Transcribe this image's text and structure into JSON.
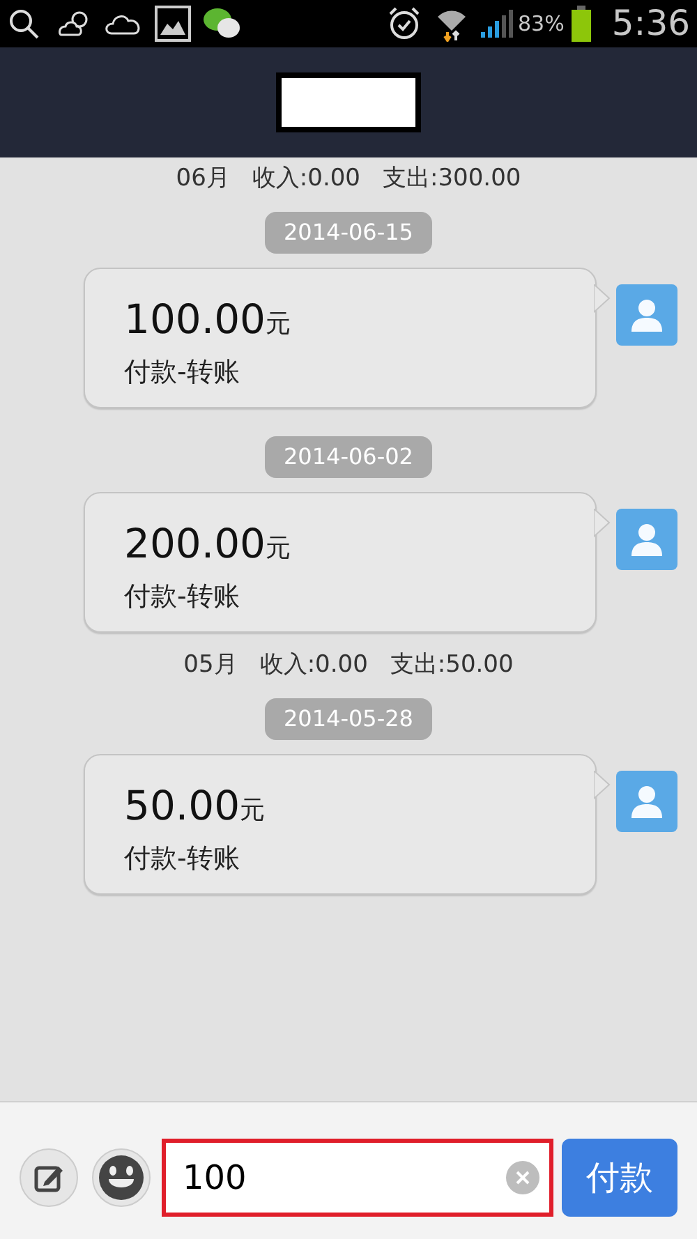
{
  "status_bar": {
    "battery": "83%",
    "time": "5:36"
  },
  "months": [
    {
      "month": "06月",
      "income": "收入:0.00",
      "expense": "支出:300.00",
      "records": [
        {
          "date": "2014-06-15",
          "amount": "100.00",
          "unit": "元",
          "note": "付款-转账"
        },
        {
          "date": "2014-06-02",
          "amount": "200.00",
          "unit": "元",
          "note": "付款-转账"
        }
      ]
    },
    {
      "month": "05月",
      "income": "收入:0.00",
      "expense": "支出:50.00",
      "records": [
        {
          "date": "2014-05-28",
          "amount": "50.00",
          "unit": "元",
          "note": "付款-转账"
        }
      ]
    }
  ],
  "input_bar": {
    "value": "100",
    "send_label": "付款"
  }
}
